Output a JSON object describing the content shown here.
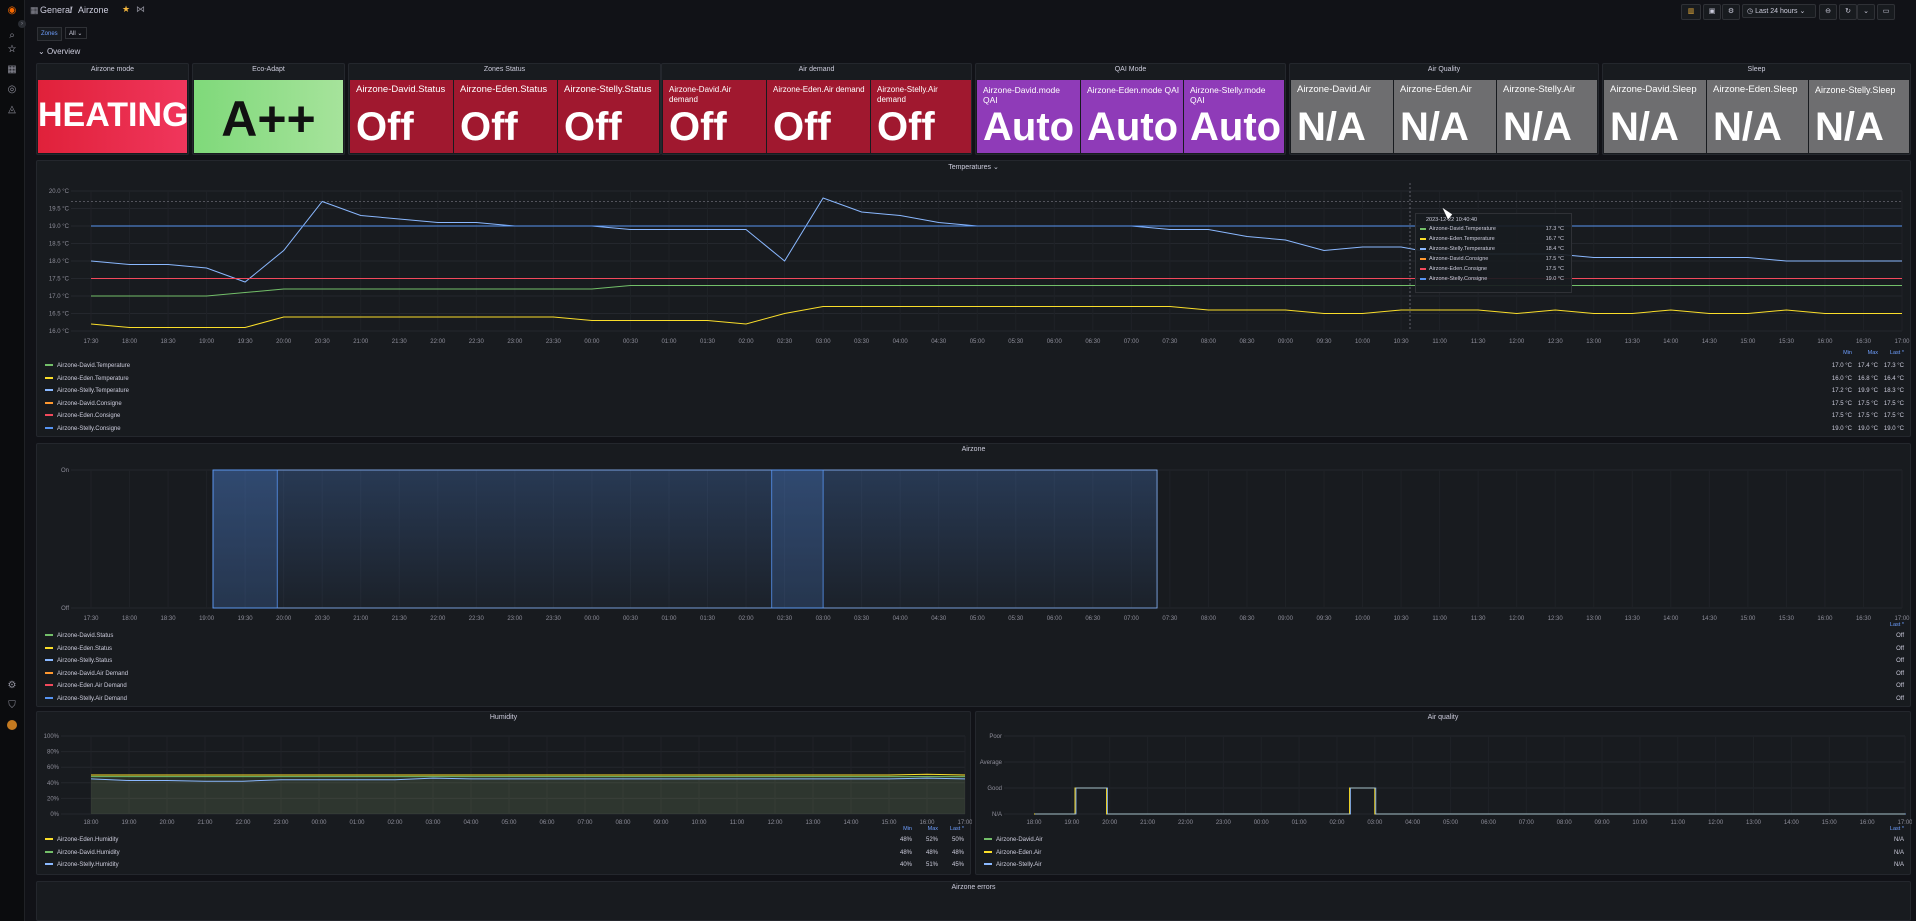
{
  "sidebar": {
    "icons": [
      "grafana-logo-icon",
      "search-icon",
      "star-icon",
      "dashboards-icon",
      "explore-icon",
      "alerting-icon",
      "settings-icon",
      "shield-icon",
      "avatar"
    ]
  },
  "header": {
    "breadcrumb_general": "General",
    "breadcrumb_sep": "/",
    "breadcrumb_page": "Airzone",
    "time_range": "Last 24 hours"
  },
  "variables": {
    "zones_label": "Zones",
    "zones_value": "All"
  },
  "row": {
    "overview": "Overview"
  },
  "groups": {
    "mode": "Airzone mode",
    "eco": "Eco-Adapt",
    "zones": "Zones Status",
    "air_demand": "Air demand",
    "qai": "QAI Mode",
    "air_quality": "Air Quality",
    "sleep": "Sleep"
  },
  "stats": {
    "mode_value": "HEATING",
    "eco_value": "A++",
    "status": [
      {
        "label": "Airzone-David.Status",
        "value": "Off"
      },
      {
        "label": "Airzone-Eden.Status",
        "value": "Off"
      },
      {
        "label": "Airzone-Stelly.Status",
        "value": "Off"
      }
    ],
    "demand": [
      {
        "label": "Airzone-David.Air demand",
        "value": "Off"
      },
      {
        "label": "Airzone-Eden.Air demand",
        "value": "Off"
      },
      {
        "label": "Airzone-Stelly.Air demand",
        "value": "Off"
      }
    ],
    "qai": [
      {
        "label": "Airzone-David.mode QAI",
        "value": "Auto"
      },
      {
        "label": "Airzone-Eden.mode QAI",
        "value": "Auto"
      },
      {
        "label": "Airzone-Stelly.mode QAI",
        "value": "Auto"
      }
    ],
    "air": [
      {
        "label": "Airzone-David.Air",
        "value": "N/A"
      },
      {
        "label": "Airzone-Eden.Air",
        "value": "N/A"
      },
      {
        "label": "Airzone-Stelly.Air",
        "value": "N/A"
      }
    ],
    "sleep": [
      {
        "label": "Airzone-David.Sleep",
        "value": "N/A"
      },
      {
        "label": "Airzone-Eden.Sleep",
        "value": "N/A"
      },
      {
        "label": "Airzone-Stelly.Sleep",
        "value": "N/A"
      }
    ]
  },
  "colors": {
    "heating": "#e02f44",
    "eco": "#96d98d",
    "red": "#a0182f",
    "purple": "#8f3bb8",
    "gray": "#6e6e70",
    "green": "#73bf69",
    "yellow": "#fade2a",
    "blue": "#8ab8ff",
    "orange": "#ff9830",
    "redline": "#f2495c",
    "blue2": "#5794f2"
  },
  "temp_panel": {
    "title": "Temperatures"
  },
  "airzone_panel": {
    "title": "Airzone"
  },
  "humidity_panel": {
    "title": "Humidity"
  },
  "airq_panel": {
    "title": "Air quality"
  },
  "errors_panel": {
    "title": "Airzone errors"
  },
  "legend_headers": {
    "min": "Min",
    "max": "Max",
    "last": "Last *"
  },
  "temp_legend": [
    {
      "name": "Airzone-David.Temperature",
      "min": "17.0 °C",
      "max": "17.4 °C",
      "last": "17.3 °C"
    },
    {
      "name": "Airzone-Eden.Temperature",
      "min": "16.0 °C",
      "max": "16.8 °C",
      "last": "16.4 °C"
    },
    {
      "name": "Airzone-Stelly.Temperature",
      "min": "17.2 °C",
      "max": "19.9 °C",
      "last": "18.3 °C"
    },
    {
      "name": "Airzone-David.Consigne",
      "min": "17.5 °C",
      "max": "17.5 °C",
      "last": "17.5 °C"
    },
    {
      "name": "Airzone-Eden.Consigne",
      "min": "17.5 °C",
      "max": "17.5 °C",
      "last": "17.5 °C"
    },
    {
      "name": "Airzone-Stelly.Consigne",
      "min": "19.0 °C",
      "max": "19.0 °C",
      "last": "19.0 °C"
    }
  ],
  "tooltip": {
    "time": "2023-12-22 10:40:40",
    "rows": [
      {
        "name": "Airzone-David.Temperature",
        "value": "17.3 °C"
      },
      {
        "name": "Airzone-Eden.Temperature",
        "value": "16.7 °C"
      },
      {
        "name": "Airzone-Stelly.Temperature",
        "value": "18.4 °C"
      },
      {
        "name": "Airzone-David.Consigne",
        "value": "17.5 °C"
      },
      {
        "name": "Airzone-Eden.Consigne",
        "value": "17.5 °C"
      },
      {
        "name": "Airzone-Stelly.Consigne",
        "value": "19.0 °C"
      }
    ]
  },
  "airzone_legend": [
    {
      "name": "Airzone-David.Status",
      "last": "Off"
    },
    {
      "name": "Airzone-Eden.Status",
      "last": "Off"
    },
    {
      "name": "Airzone-Stelly.Status",
      "last": "Off"
    },
    {
      "name": "Airzone-David.Air Demand",
      "last": "Off"
    },
    {
      "name": "Airzone-Eden.Air Demand",
      "last": "Off"
    },
    {
      "name": "Airzone-Stelly.Air Demand",
      "last": "Off"
    }
  ],
  "humidity_legend": [
    {
      "name": "Airzone-Eden.Humidity",
      "min": "48%",
      "max": "52%",
      "last": "50%"
    },
    {
      "name": "Airzone-David.Humidity",
      "min": "48%",
      "max": "48%",
      "last": "48%"
    },
    {
      "name": "Airzone-Stelly.Humidity",
      "min": "40%",
      "max": "51%",
      "last": "45%"
    }
  ],
  "airq_legend": [
    {
      "name": "Airzone-David.Air",
      "last": "N/A"
    },
    {
      "name": "Airzone-Eden.Air",
      "last": "N/A"
    },
    {
      "name": "Airzone-Stelly.Air",
      "last": "N/A"
    }
  ],
  "chart_data": [
    {
      "type": "line",
      "title": "Temperatures",
      "yticks": [
        "16.0 °C",
        "16.5 °C",
        "17.0 °C",
        "17.5 °C",
        "18.0 °C",
        "18.5 °C",
        "19.0 °C",
        "19.5 °C",
        "20.0 °C"
      ],
      "ylim": [
        16.0,
        20.0
      ],
      "x": [
        "17:30",
        "18:00",
        "18:30",
        "19:00",
        "19:30",
        "20:00",
        "20:30",
        "21:00",
        "21:30",
        "22:00",
        "22:30",
        "23:00",
        "23:30",
        "00:00",
        "00:30",
        "01:00",
        "01:30",
        "02:00",
        "02:30",
        "03:00",
        "03:30",
        "04:00",
        "04:30",
        "05:00",
        "05:30",
        "06:00",
        "06:30",
        "07:00",
        "07:30",
        "08:00",
        "08:30",
        "09:00",
        "09:30",
        "10:00",
        "10:30",
        "11:00",
        "11:30",
        "12:00",
        "12:30",
        "13:00",
        "13:30",
        "14:00",
        "14:30",
        "15:00",
        "15:30",
        "16:00",
        "16:30",
        "17:00"
      ],
      "series": [
        {
          "name": "Airzone-David.Temperature",
          "values": [
            17.0,
            17.0,
            17.0,
            17.0,
            17.1,
            17.2,
            17.2,
            17.2,
            17.2,
            17.2,
            17.2,
            17.2,
            17.2,
            17.2,
            17.3,
            17.3,
            17.3,
            17.3,
            17.3,
            17.3,
            17.3,
            17.3,
            17.3,
            17.3,
            17.3,
            17.3,
            17.3,
            17.3,
            17.3,
            17.3,
            17.3,
            17.3,
            17.3,
            17.3,
            17.3,
            17.3,
            17.3,
            17.3,
            17.3,
            17.3,
            17.3,
            17.3,
            17.3,
            17.3,
            17.3,
            17.3,
            17.3,
            17.3
          ]
        },
        {
          "name": "Airzone-Eden.Temperature",
          "values": [
            16.2,
            16.1,
            16.1,
            16.1,
            16.1,
            16.4,
            16.4,
            16.4,
            16.4,
            16.4,
            16.4,
            16.4,
            16.4,
            16.3,
            16.3,
            16.3,
            16.3,
            16.2,
            16.5,
            16.7,
            16.7,
            16.7,
            16.7,
            16.7,
            16.7,
            16.7,
            16.7,
            16.7,
            16.7,
            16.6,
            16.6,
            16.6,
            16.5,
            16.5,
            16.6,
            16.6,
            16.6,
            16.5,
            16.6,
            16.5,
            16.5,
            16.6,
            16.5,
            16.5,
            16.6,
            16.5,
            16.5,
            16.5
          ]
        },
        {
          "name": "Airzone-Stelly.Temperature",
          "values": [
            18.0,
            17.9,
            17.9,
            17.8,
            17.4,
            18.3,
            19.7,
            19.3,
            19.2,
            19.1,
            19.1,
            19.0,
            19.0,
            19.0,
            18.9,
            18.9,
            18.9,
            18.9,
            18.0,
            19.8,
            19.4,
            19.3,
            19.1,
            19.0,
            19.0,
            19.0,
            19.0,
            19.0,
            18.9,
            18.9,
            18.7,
            18.6,
            18.3,
            18.4,
            18.4,
            18.2,
            18.2,
            18.2,
            18.2,
            18.1,
            18.1,
            18.1,
            18.1,
            18.1,
            18.0,
            18.0,
            18.0,
            18.0
          ]
        },
        {
          "name": "Airzone-David.Consigne",
          "values": [
            17.5,
            17.5,
            17.5,
            17.5,
            17.5,
            17.5,
            17.5,
            17.5,
            17.5,
            17.5,
            17.5,
            17.5,
            17.5,
            17.5,
            17.5,
            17.5,
            17.5,
            17.5,
            17.5,
            17.5,
            17.5,
            17.5,
            17.5,
            17.5,
            17.5,
            17.5,
            17.5,
            17.5,
            17.5,
            17.5,
            17.5,
            17.5,
            17.5,
            17.5,
            17.5,
            17.5,
            17.5,
            17.5,
            17.5,
            17.5,
            17.5,
            17.5,
            17.5,
            17.5,
            17.5,
            17.5,
            17.5,
            17.5
          ]
        },
        {
          "name": "Airzone-Eden.Consigne",
          "values": [
            17.5,
            17.5,
            17.5,
            17.5,
            17.5,
            17.5,
            17.5,
            17.5,
            17.5,
            17.5,
            17.5,
            17.5,
            17.5,
            17.5,
            17.5,
            17.5,
            17.5,
            17.5,
            17.5,
            17.5,
            17.5,
            17.5,
            17.5,
            17.5,
            17.5,
            17.5,
            17.5,
            17.5,
            17.5,
            17.5,
            17.5,
            17.5,
            17.5,
            17.5,
            17.5,
            17.5,
            17.5,
            17.5,
            17.5,
            17.5,
            17.5,
            17.5,
            17.5,
            17.5,
            17.5,
            17.5,
            17.5,
            17.5
          ]
        },
        {
          "name": "Airzone-Stelly.Consigne",
          "values": [
            19.0,
            19.0,
            19.0,
            19.0,
            19.0,
            19.0,
            19.0,
            19.0,
            19.0,
            19.0,
            19.0,
            19.0,
            19.0,
            19.0,
            19.0,
            19.0,
            19.0,
            19.0,
            19.0,
            19.0,
            19.0,
            19.0,
            19.0,
            19.0,
            19.0,
            19.0,
            19.0,
            19.0,
            19.0,
            19.0,
            19.0,
            19.0,
            19.0,
            19.0,
            19.0,
            19.0,
            19.0,
            19.0,
            19.0,
            19.0,
            19.0,
            19.0,
            19.0,
            19.0,
            19.0,
            19.0,
            19.0,
            19.0
          ]
        }
      ]
    },
    {
      "type": "line",
      "title": "Airzone",
      "yticks": [
        "Off",
        "On"
      ],
      "x": [
        "17:30",
        "18:00",
        "18:30",
        "19:00",
        "19:30",
        "20:00",
        "20:30",
        "21:00",
        "21:30",
        "22:00",
        "22:30",
        "23:00",
        "23:30",
        "00:00",
        "00:30",
        "01:00",
        "01:30",
        "02:00",
        "02:30",
        "03:00",
        "03:30",
        "04:00",
        "04:30",
        "05:00",
        "05:30",
        "06:00",
        "06:30",
        "07:00",
        "07:30",
        "08:00",
        "08:30",
        "09:00",
        "09:30",
        "10:00",
        "10:30",
        "11:00",
        "11:30",
        "12:00",
        "12:30",
        "13:00",
        "13:30",
        "14:00",
        "14:30",
        "15:00",
        "15:30",
        "16:00",
        "16:30",
        "17:00"
      ],
      "on_intervals": [
        [
          "19:05",
          "07:20"
        ]
      ],
      "series_intervals": [
        {
          "name": "Airzone-Stelly.Air Demand",
          "on": [
            [
              "19:05",
              "19:55"
            ],
            [
              "02:20",
              "03:00"
            ]
          ]
        }
      ]
    },
    {
      "type": "line",
      "title": "Humidity",
      "yticks": [
        "0%",
        "20%",
        "40%",
        "60%",
        "80%",
        "100%"
      ],
      "ylim": [
        0,
        100
      ],
      "x": [
        "18:00",
        "19:00",
        "20:00",
        "21:00",
        "22:00",
        "23:00",
        "00:00",
        "01:00",
        "02:00",
        "03:00",
        "04:00",
        "05:00",
        "06:00",
        "07:00",
        "08:00",
        "09:00",
        "10:00",
        "11:00",
        "12:00",
        "13:00",
        "14:00",
        "15:00",
        "16:00",
        "17:00"
      ],
      "series": [
        {
          "name": "Airzone-Eden.Humidity",
          "values": [
            50,
            50,
            50,
            50,
            50,
            50,
            50,
            50,
            50,
            50,
            50,
            50,
            50,
            50,
            50,
            50,
            50,
            50,
            50,
            50,
            50,
            50,
            51,
            50
          ]
        },
        {
          "name": "Airzone-David.Humidity",
          "values": [
            48,
            48,
            48,
            48,
            48,
            48,
            48,
            48,
            48,
            48,
            48,
            48,
            48,
            48,
            48,
            48,
            48,
            48,
            48,
            48,
            48,
            48,
            48,
            48
          ]
        },
        {
          "name": "Airzone-Stelly.Humidity",
          "values": [
            45,
            43,
            43,
            42,
            42,
            44,
            44,
            44,
            44,
            46,
            45,
            45,
            45,
            45,
            45,
            45,
            45,
            45,
            45,
            45,
            45,
            45,
            46,
            45
          ]
        }
      ]
    },
    {
      "type": "line",
      "title": "Air quality",
      "yticks": [
        "N/A",
        "Good",
        "Average",
        "Poor"
      ],
      "x": [
        "18:00",
        "19:00",
        "20:00",
        "21:00",
        "22:00",
        "23:00",
        "00:00",
        "01:00",
        "02:00",
        "03:00",
        "04:00",
        "05:00",
        "06:00",
        "07:00",
        "08:00",
        "09:00",
        "10:00",
        "11:00",
        "12:00",
        "13:00",
        "14:00",
        "15:00",
        "16:00",
        "17:00"
      ],
      "good_intervals": [
        [
          "19:05",
          "19:55"
        ],
        [
          "02:20",
          "03:00"
        ]
      ]
    }
  ]
}
